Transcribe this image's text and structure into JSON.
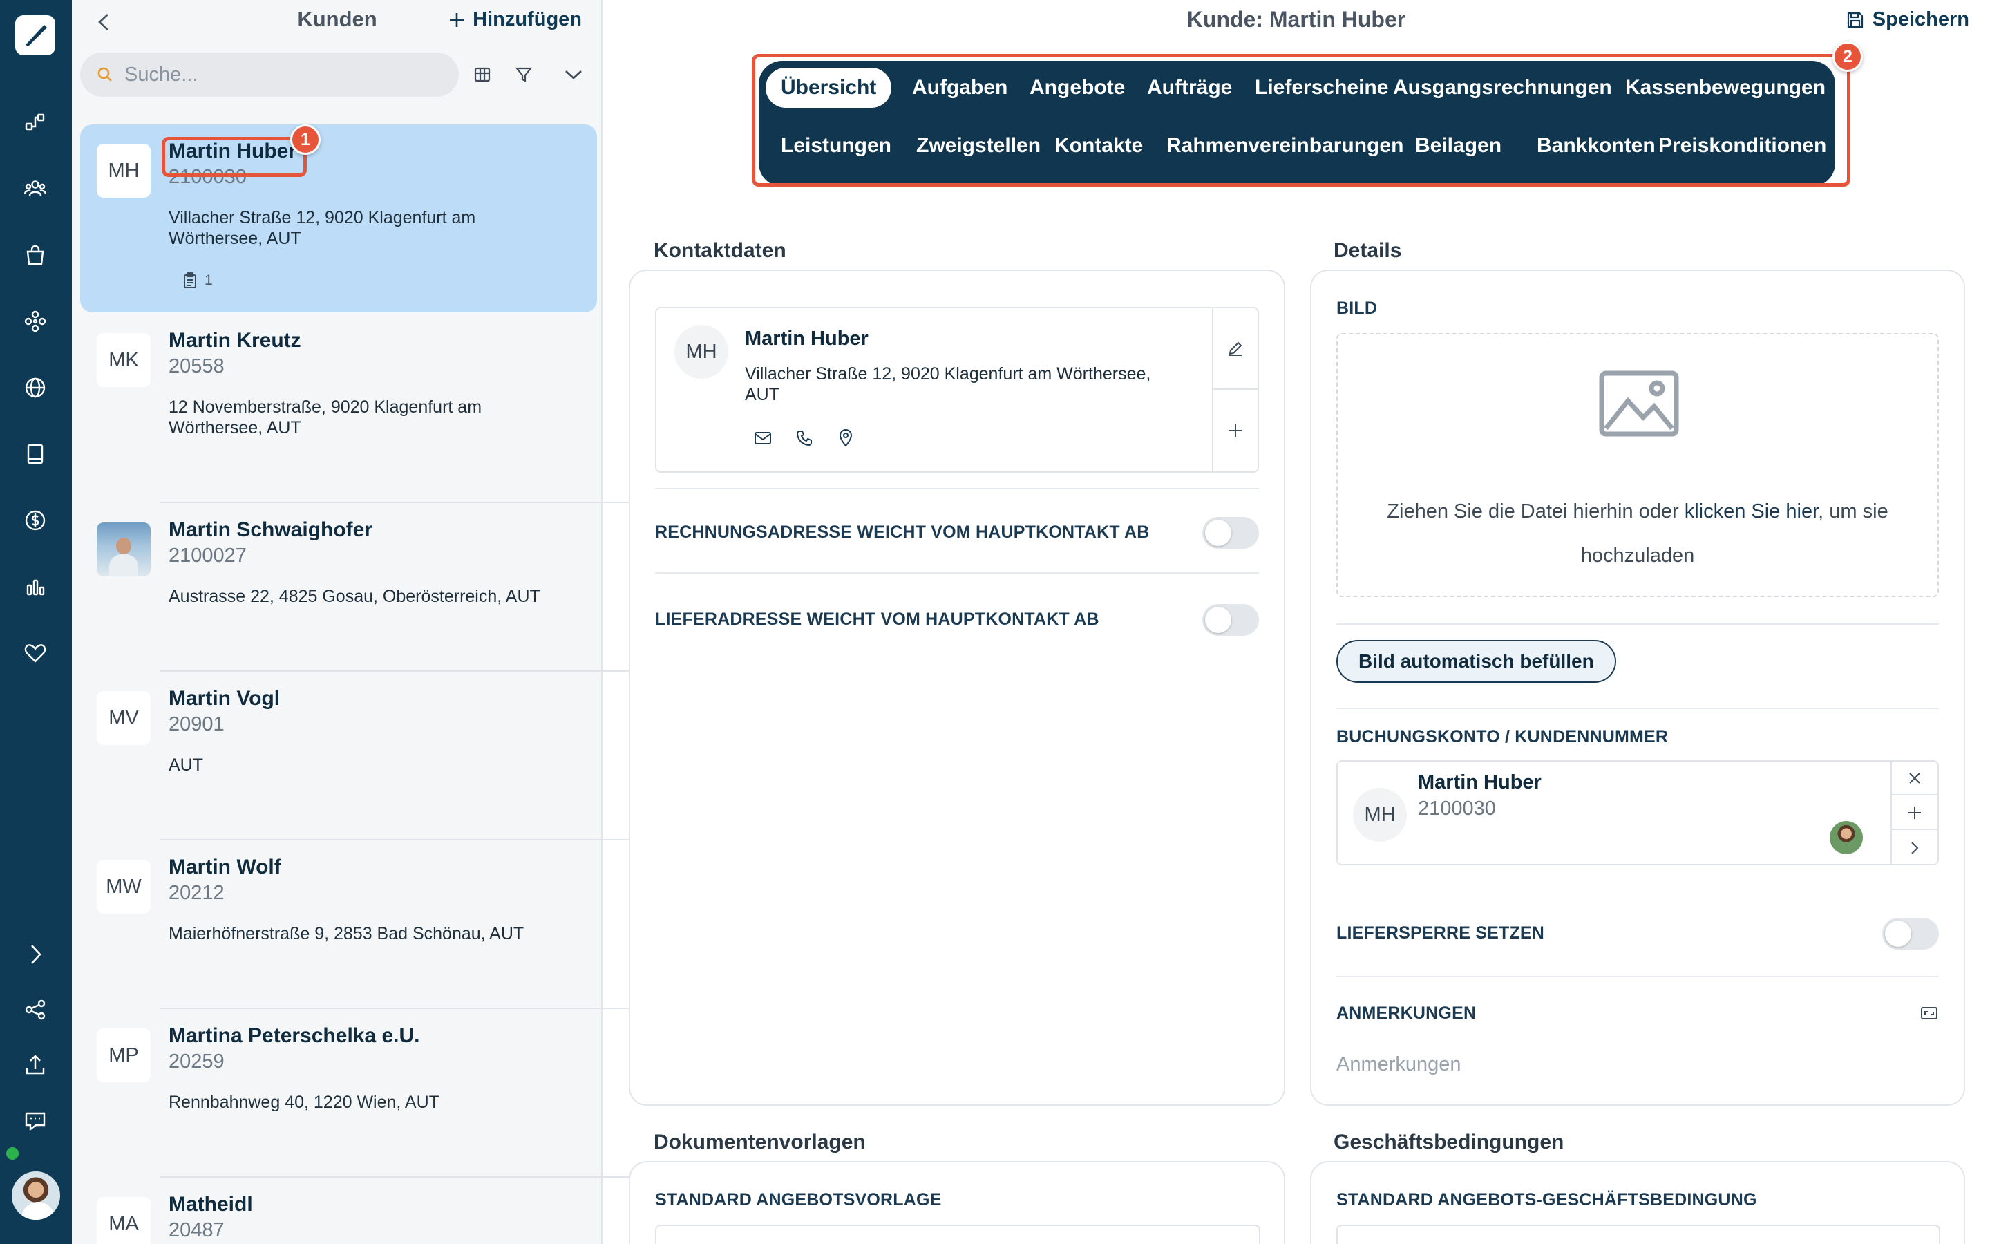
{
  "nav_rail": {
    "items": [
      {
        "icon": "flow-icon"
      },
      {
        "icon": "users-icon"
      },
      {
        "icon": "shopping-bag-icon"
      },
      {
        "icon": "modules-icon"
      },
      {
        "icon": "globe-icon"
      },
      {
        "icon": "book-icon"
      },
      {
        "icon": "dollar-icon"
      },
      {
        "icon": "bar-chart-icon"
      },
      {
        "icon": "heart-icon"
      }
    ],
    "bottom_items": [
      {
        "icon": "chevron-right-icon"
      },
      {
        "icon": "share-icon"
      },
      {
        "icon": "upload-icon"
      },
      {
        "icon": "chat-icon"
      }
    ]
  },
  "list_panel": {
    "title": "Kunden",
    "add_label": "Hinzufügen",
    "search_placeholder": "Suche...",
    "customers": [
      {
        "initials": "MH",
        "name": "Martin Huber",
        "number": "2100030",
        "address": "Villacher Straße 12, 9020 Klagenfurt am Wörthersee, AUT",
        "doc_count": "1",
        "selected": true
      },
      {
        "initials": "MK",
        "name": "Martin Kreutz",
        "number": "20558",
        "address": "12 Novemberstraße, 9020 Klagenfurt am Wörthersee, AUT"
      },
      {
        "initials": "",
        "name": "Martin Schwaighofer",
        "number": "2100027",
        "address": "Austrasse 22, 4825 Gosau, Oberösterreich, AUT",
        "photo": true
      },
      {
        "initials": "MV",
        "name": "Martin Vogl",
        "number": "20901",
        "address": "AUT"
      },
      {
        "initials": "MW",
        "name": "Martin Wolf",
        "number": "20212",
        "address": "Maierhöfnerstraße 9, 2853 Bad Schönau, AUT"
      },
      {
        "initials": "MP",
        "name": "Martina Peterschelka e.U.",
        "number": "20259",
        "address": "Rennbahnweg 40, 1220 Wien, AUT"
      },
      {
        "initials": "MA",
        "name": "Matheidl",
        "number": "20487",
        "address": ""
      }
    ]
  },
  "callouts": [
    "1",
    "2"
  ],
  "main": {
    "title": "Kunde: Martin Huber",
    "save_label": "Speichern",
    "tabs_row1": [
      "Übersicht",
      "Aufgaben",
      "Angebote",
      "Aufträge",
      "Lieferscheine",
      "Ausgangsrechnungen",
      "Kassenbewegungen"
    ],
    "tabs_row2": [
      "Leistungen",
      "Zweigstellen",
      "Kontakte",
      "Rahmenvereinbarungen",
      "Beilagen",
      "Bankkonten",
      "Preiskonditionen"
    ],
    "active_tab": "Übersicht",
    "contact_section": {
      "title": "Kontaktdaten",
      "initials": "MH",
      "name": "Martin Huber",
      "address": "Villacher Straße 12, 9020 Klagenfurt am Wörthersee, AUT",
      "billing_toggle_label": "RECHNUNGSADRESSE WEICHT VOM HAUPTKONTAKT AB",
      "billing_toggle_on": false,
      "delivery_toggle_label": "LIEFERADRESSE WEICHT VOM HAUPTKONTAKT AB",
      "delivery_toggle_on": false
    },
    "details_section": {
      "title": "Details",
      "image_label": "BILD",
      "drop_text_before": "Ziehen Sie die Datei hierhin oder ",
      "drop_link": "klicken Sie hier",
      "drop_text_after": ", um sie hochzuladen",
      "autofill_button": "Bild automatisch befüllen",
      "account_label": "BUCHUNGSKONTO / KUNDENNUMMER",
      "account_initials": "MH",
      "account_name": "Martin Huber",
      "account_number": "2100030",
      "delivery_block_label": "LIEFERSPERRE SETZEN",
      "delivery_block_on": false,
      "notes_label": "ANMERKUNGEN",
      "notes_placeholder": "Anmerkungen"
    },
    "templates_section": {
      "title": "Dokumentenvorlagen",
      "field_label": "STANDARD ANGEBOTSVORLAGE"
    },
    "terms_section": {
      "title": "Geschäftsbedingungen",
      "field_label": "STANDARD ANGEBOTS-GESCHÄFTSBEDINGUNG"
    }
  },
  "colors": {
    "rail": "#0f3a55",
    "tabs_bg": "#10374f",
    "selected_item": "#bcdcf7",
    "callout": "#e6553a"
  }
}
